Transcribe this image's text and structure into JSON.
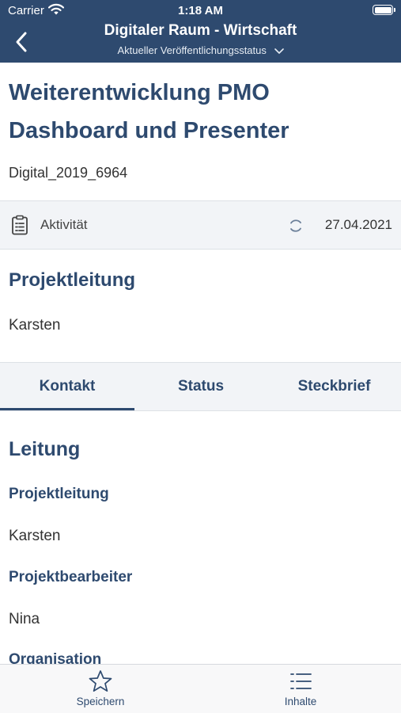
{
  "status_bar": {
    "carrier": "Carrier",
    "time": "1:18 AM"
  },
  "nav": {
    "title": "Digitaler Raum - Wirtschaft",
    "subtitle": "Aktueller Veröffentlichungsstatus"
  },
  "project": {
    "title": "Weiterentwicklung PMO Dashboard und Presenter",
    "id": "Digital_2019_6964",
    "type": "Aktivität",
    "date": "27.04.2021",
    "lead_heading": "Projektleitung",
    "lead_name": "Karsten"
  },
  "tabs": [
    {
      "label": "Kontakt",
      "active": true
    },
    {
      "label": "Status",
      "active": false
    },
    {
      "label": "Steckbrief",
      "active": false
    }
  ],
  "content": {
    "heading": "Leitung",
    "fields": [
      {
        "label": "Projektleitung",
        "value": "Karsten"
      },
      {
        "label": "Projektbearbeiter",
        "value": "Nina"
      },
      {
        "label": "Organisation",
        "value": ""
      }
    ]
  },
  "tab_bar": [
    {
      "label": "Speichern",
      "icon": "star-icon"
    },
    {
      "label": "Inhalte",
      "icon": "list-icon"
    }
  ],
  "colors": {
    "primary": "#2e4a6f",
    "surface": "#f2f4f7",
    "text": "#333333"
  }
}
